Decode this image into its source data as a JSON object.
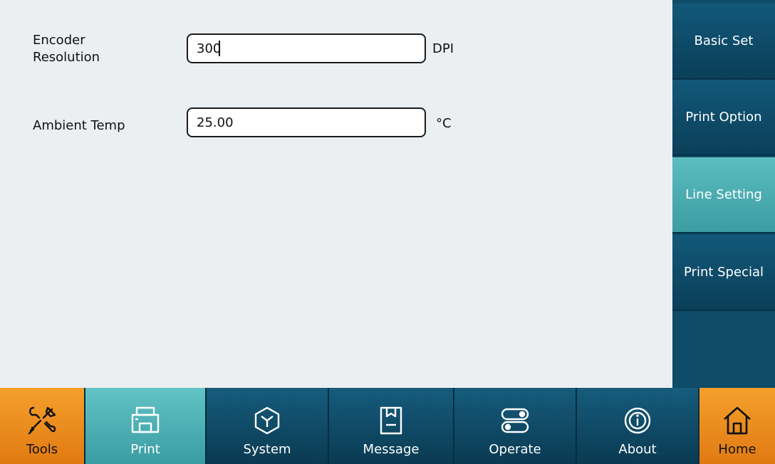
{
  "fields": {
    "encoder": {
      "label_line1": "Encoder",
      "label_line2": "Resolution",
      "value": "300",
      "unit": "DPI"
    },
    "ambient": {
      "label": "Ambient Temp",
      "value": "25.00",
      "unit": "°C"
    }
  },
  "sidebar": {
    "items": [
      {
        "label": "Basic Set"
      },
      {
        "label": "Print Option"
      },
      {
        "label": "Line Setting"
      },
      {
        "label": "Print Special"
      }
    ]
  },
  "bottom_nav": {
    "items": [
      {
        "label": "Tools",
        "icon": "tools-icon"
      },
      {
        "label": "Print",
        "icon": "printer-icon"
      },
      {
        "label": "System",
        "icon": "system-icon"
      },
      {
        "label": "Message",
        "icon": "message-icon"
      },
      {
        "label": "Operate",
        "icon": "operate-icon"
      },
      {
        "label": "About",
        "icon": "info-icon"
      },
      {
        "label": "Home",
        "icon": "home-icon"
      }
    ]
  },
  "colors": {
    "navy": "#0e4c6a",
    "teal_active": "#4fb3b7",
    "orange": "#ef8d1e"
  }
}
